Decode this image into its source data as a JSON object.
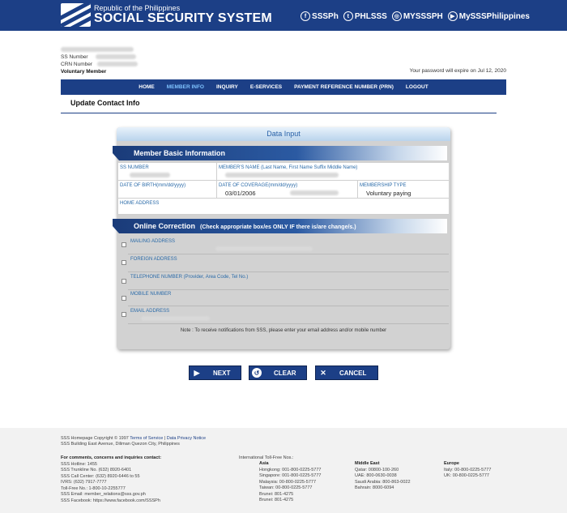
{
  "header": {
    "org_small": "Republic of the Philippines",
    "org_big": "SOCIAL SECURITY SYSTEM",
    "socials": [
      {
        "icon": "facebook-icon",
        "glyph": "f",
        "label": "SSSPh"
      },
      {
        "icon": "twitter-icon",
        "glyph": "t",
        "label": "PHLSSS"
      },
      {
        "icon": "instagram-icon",
        "glyph": "◎",
        "label": "MYSSSPH"
      },
      {
        "icon": "youtube-icon",
        "glyph": "▶",
        "label": "MySSSPhilippines"
      }
    ]
  },
  "member": {
    "ss_label": "SS Number",
    "crn_label": "CRN Number",
    "type": "Voluntary Member",
    "password_notice": "Your password will expire on Jul 12, 2020"
  },
  "nav": [
    "HOME",
    "MEMBER INFO",
    "INQUIRY",
    "E-SERVICES",
    "PAYMENT REFERENCE NUMBER (PRN)",
    "LOGOUT"
  ],
  "page_title": "Update Contact Info",
  "form": {
    "header": "Data Input",
    "basic_title": "Member Basic Information",
    "ss_number_label": "SS NUMBER",
    "name_label": "MEMBER'S NAME  (Last Name, First Name Suffix Middle Name)",
    "dob_label": "DATE OF BIRTH(mm/dd/yyyy)",
    "coverage_label": "DATE OF COVERAGE(mm/dd/yyyy)",
    "coverage_value": "03/01/2006",
    "membership_label": "MEMBERSHIP TYPE",
    "membership_value": "Voluntary paying",
    "home_address_label": "HOME ADDRESS",
    "correction_title": "Online Correction",
    "correction_sub": "(Check appropriate box/es ONLY IF there is/are change/s.)",
    "corrections": [
      "MAILING ADDRESS",
      "FOREIGN ADDRESS",
      "TELEPHONE NUMBER (Provider, Area Code, Tel No.)",
      "MOBILE NUMBER",
      "EMAIL ADDRESS"
    ],
    "note": "Note : To receive notifications from SSS, please enter your email address and/or mobile number"
  },
  "buttons": {
    "next": "NEXT",
    "clear": "CLEAR",
    "cancel": "CANCEL"
  },
  "footer": {
    "copyright": "SSS Homepage Copyright © 1997",
    "terms": "Terms of Service",
    "privacy": "Data Privacy Notice",
    "address": "SSS Building East Avenue, Diliman Quezon City, Philippines",
    "contacts_title": "For comments, concerns and inquiries contact:",
    "contacts": [
      "SSS Hotline: 1455",
      "SSS Trunkline No. (632) 8920-6401",
      "SSS Call Center: (632) 8920-6446 to 55",
      "IVRS: (632) 7917-7777",
      "Toll-Free No.: 1-800-10-2255777",
      "SSS Email: member_relations@sss.gov.ph",
      "SSS Facebook: https://www.facebook.com/SSSPh"
    ],
    "tollfree_title": "International Toll-Free Nos.:",
    "asia_title": "Asia",
    "asia": [
      "Hongkong: 001-800-0225-5777",
      "Singapore: 001-800-0225-5777",
      "Malaysia: 00-800-0225-5777",
      "Taiwan: 00-800-0225-5777",
      "Brunei: 801-4275",
      "Brunei: 801-4275"
    ],
    "me_title": "Middle East",
    "middle_east": [
      "Qatar: 00800-100-260",
      "UAE: 800-0630-0038",
      "Saudi Arabia: 800-863-0022",
      "Bahrain: 8000-6094"
    ],
    "eu_title": "Europe",
    "europe": [
      "Italy: 00-800-0225-5777",
      "UK: 00-800-0225-5777"
    ]
  }
}
